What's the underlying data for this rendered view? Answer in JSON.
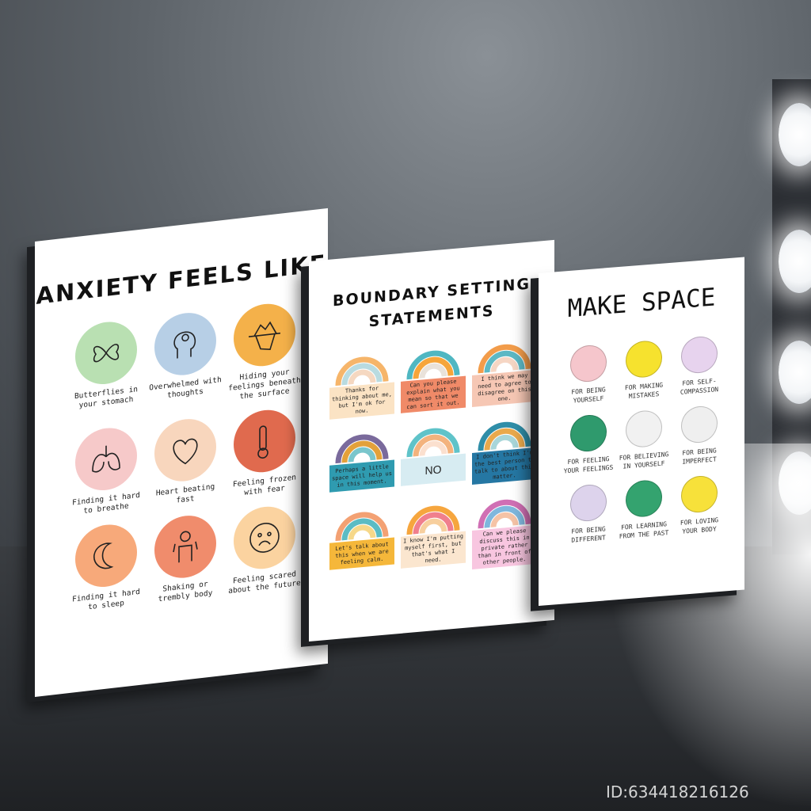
{
  "watermark": "ID:634418216126",
  "anxiety": {
    "title": "ANXIETY FEELS LIKE",
    "items": [
      {
        "text": "Butterflies in your stomach",
        "color": "#b9e0b2",
        "icon": "butterfly-icon"
      },
      {
        "text": "Overwhelmed with thoughts",
        "color": "#b7cfe6",
        "icon": "head-swirl-icon"
      },
      {
        "text": "Hiding your feelings beneath the surface",
        "color": "#f4b14a",
        "icon": "iceberg-icon"
      },
      {
        "text": "Finding it hard to breathe",
        "color": "#f6c9c9",
        "icon": "lungs-icon"
      },
      {
        "text": "Heart beating fast",
        "color": "#f8d6bd",
        "icon": "heart-icon"
      },
      {
        "text": "Feeling frozen with fear",
        "color": "#e06a4e",
        "icon": "thermometer-icon"
      },
      {
        "text": "Finding it hard to sleep",
        "color": "#f7a97a",
        "icon": "moon-icon"
      },
      {
        "text": "Shaking or trembly body",
        "color": "#f08c6c",
        "icon": "trembling-person-icon"
      },
      {
        "text": "Feeling scared about the future",
        "color": "#fbd3a0",
        "icon": "scared-face-icon"
      }
    ]
  },
  "boundary": {
    "title_line1": "BOUNDARY SETTING",
    "title_line2": "STATEMENTS",
    "items": [
      {
        "text": "Thanks for thinking about me, but I'm ok for now.",
        "note_color": "#fbe3c4",
        "arc_colors": [
          "#f6b56a",
          "#b9dbe0",
          "#f5d8c1"
        ]
      },
      {
        "text": "Can you please explain what you mean so that we can sort it out.",
        "note_color": "#f08a68",
        "arc_colors": [
          "#4fb7c2",
          "#f6a53a",
          "#e9e2da"
        ]
      },
      {
        "text": "I think we may need to agree to disagree on this one.",
        "note_color": "#f6c7b4",
        "arc_colors": [
          "#f29c4a",
          "#5cb8c4",
          "#f6d6c4"
        ]
      },
      {
        "text": "Perhaps a little space will help us in this moment.",
        "note_color": "#2f9bb0",
        "arc_colors": [
          "#7a6a9c",
          "#e3a13a",
          "#7ac6cc"
        ]
      },
      {
        "text": "NO",
        "note_color": "#d7ecf2",
        "arc_colors": [
          "#5fc3c9",
          "#f3b37e",
          "#fbe0cf"
        ]
      },
      {
        "text": "I don't think I'm the best person to talk to about this matter.",
        "note_color": "#2577a3",
        "arc_colors": [
          "#2f8ea8",
          "#e9a94c",
          "#a8d6d9"
        ]
      },
      {
        "text": "Let's talk about this when we are feeling calm.",
        "note_color": "#f5b73a",
        "arc_colors": [
          "#f3a173",
          "#5bbcc4",
          "#f6d88a"
        ]
      },
      {
        "text": "I know I'm putting myself first, but that's what I need.",
        "note_color": "#fbe6cf",
        "arc_colors": [
          "#f6a63e",
          "#f07f8d",
          "#f7cf9e"
        ]
      },
      {
        "text": "Can we please discuss this in private rather than in front of other people.",
        "note_color": "#f8c6e0",
        "arc_colors": [
          "#d06fb4",
          "#7fb7dd",
          "#f5c3a6"
        ]
      }
    ]
  },
  "space": {
    "title": "MAKE SPACE",
    "items": [
      {
        "text": "FOR BEING YOURSELF",
        "color": "#f5c6cc",
        "icon": "ringed-planet-icon"
      },
      {
        "text": "FOR MAKING MISTAKES",
        "color": "#f6e22e",
        "icon": "yellow-planet-icon"
      },
      {
        "text": "FOR SELF-COMPASSION",
        "color": "#e7d3ee",
        "icon": "lilac-planet-icon"
      },
      {
        "text": "FOR FEELING YOUR FEELINGS",
        "color": "#2f9a6d",
        "icon": "green-planet-icon"
      },
      {
        "text": "FOR BELIEVING IN YOURSELF",
        "color": "#f1f1f1",
        "icon": "striped-planet-icon"
      },
      {
        "text": "FOR BEING IMPERFECT",
        "color": "#efefef",
        "icon": "swirl-planet-icon"
      },
      {
        "text": "FOR BEING DIFFERENT",
        "color": "#ddd3ec",
        "icon": "purple-planet-icon"
      },
      {
        "text": "FOR LEARNING FROM THE PAST",
        "color": "#34a36f",
        "icon": "green-planet-icon"
      },
      {
        "text": "FOR LOVING YOUR BODY",
        "color": "#f7e13a",
        "icon": "yellow-planet-icon"
      }
    ]
  }
}
